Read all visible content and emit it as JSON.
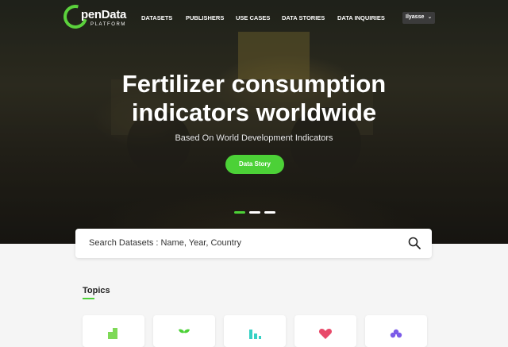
{
  "logo": {
    "name_part": "penData",
    "sub": "PLATFORM",
    "accent": "#5bd13c"
  },
  "nav": {
    "items": [
      "DATASETS",
      "PUBLISHERS",
      "USE CASES",
      "DATA STORIES",
      "DATA INQUIRIES"
    ],
    "user": "Ilyasse"
  },
  "hero": {
    "title_line1": "Fertilizer consumption",
    "title_line2": "indicators worldwide",
    "subtitle": "Based On World Development Indicators",
    "cta": "Data Story",
    "slides": 3,
    "active_slide": 1
  },
  "search": {
    "placeholder": "Search Datasets : Name, Year, Country"
  },
  "topics": {
    "title": "Topics",
    "icons": [
      "agriculture-icon",
      "plant-icon",
      "chart-icon",
      "health-icon",
      "community-icon"
    ]
  },
  "colors": {
    "accent": "#4cd137",
    "background": "#f5f5f5"
  }
}
